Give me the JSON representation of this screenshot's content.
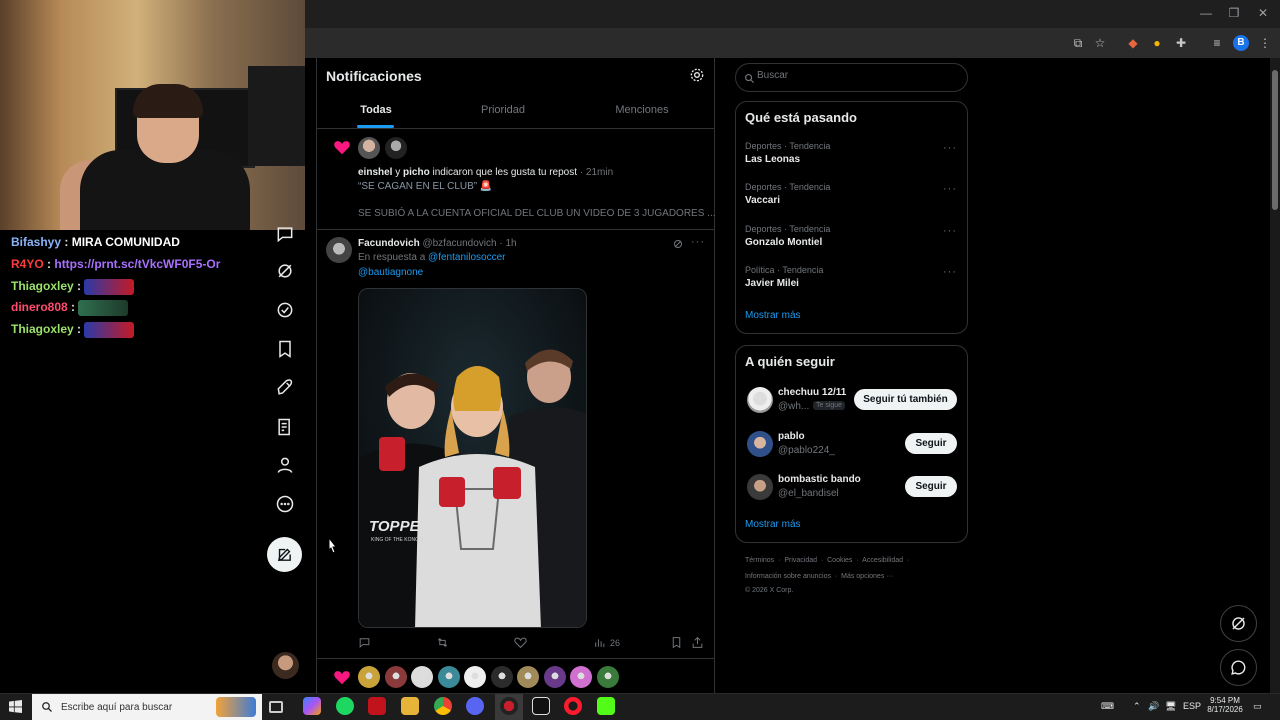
{
  "chat": [
    {
      "user": "Bifashyy",
      "color": "#8ab4f8",
      "message": "MIRA COMUNIDAD",
      "msg_color": "#ffffff"
    },
    {
      "user": "R4YO",
      "color": "#ff3b3b",
      "message": "https://prnt.sc/tVkcWF0F5-Or",
      "msg_color": "#a970ff"
    },
    {
      "user": "Thiagoxley",
      "color": "#9be26b",
      "message": "",
      "emote": true
    },
    {
      "user": "dinero808",
      "color": "#ff4d6d",
      "message": "",
      "emote": true
    },
    {
      "user": "Thiagoxley",
      "color": "#9be26b",
      "message": "",
      "emote": true
    }
  ],
  "notifications": {
    "title": "Notificaciones",
    "tabs": [
      "Todas",
      "Prioridad",
      "Menciones"
    ],
    "like_notif": {
      "user1": "einshel",
      "connector": "y",
      "user2": "picho",
      "action": "indicaron que les gusta tu repost",
      "time": "· 21min",
      "quote": "“SE CAGAN EN EL CLUB” 🚨",
      "preview": "SE SUBIÓ A LA CUENTA OFICIAL DEL CLUB UN VIDEO DE 3 JUGADORES ..."
    },
    "tweet": {
      "name": "Facundovich",
      "handle": "@bzfacundovich",
      "time": "· 1h",
      "reply_prefix": "En respuesta a",
      "reply_to_1": "@fentanilosoccer",
      "reply_to_2": "@bautiagnone",
      "views": "26",
      "image_text_brand": "TOPPE",
      "image_text_sub": "KING OF THE KONGO"
    }
  },
  "search": {
    "placeholder": "Buscar"
  },
  "trends": {
    "title": "Qué está pasando",
    "items": [
      {
        "meta": "Deportes · Tendencia",
        "name": "Las Leonas"
      },
      {
        "meta": "Deportes · Tendencia",
        "name": "Vaccari"
      },
      {
        "meta": "Deportes · Tendencia",
        "name": "Gonzalo Montiel"
      },
      {
        "meta": "Política · Tendencia",
        "name": "Javier Milei"
      }
    ],
    "more": "Mostrar más"
  },
  "who_to_follow": {
    "title": "A quién seguir",
    "items": [
      {
        "name": "chechuu 12/11",
        "handle": "@wh...",
        "badge": "Te sigue",
        "button": "Seguir tú también"
      },
      {
        "name": "pablo",
        "handle": "@pablo224_",
        "button": "Seguir"
      },
      {
        "name": "bombastic bando",
        "handle": "@el_bandisel",
        "button": "Seguir"
      }
    ],
    "more": "Mostrar más"
  },
  "footer": {
    "row1": [
      "Términos",
      "·",
      "Privacidad",
      "·",
      "Cookies",
      "·",
      "Accesibilidad",
      "·"
    ],
    "row2": [
      "Información sobre anuncios",
      "·",
      "Más opciones ···"
    ],
    "copyright": "© 2026 X Corp."
  },
  "taskbar": {
    "search_placeholder": "Escribe aquí para buscar",
    "lang": "ESP",
    "time": "9:54 PM",
    "date": "8/17/2026"
  },
  "colors": {
    "accent": "#1d9bf0",
    "like": "#f91880"
  }
}
